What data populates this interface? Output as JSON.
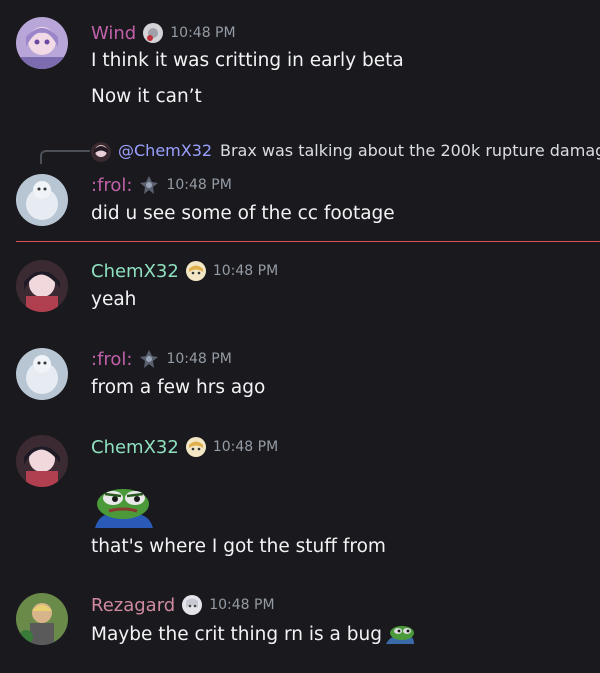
{
  "colors": {
    "wind": "#c060a8",
    "frol": "#c060a8",
    "chem": "#8fe0c0",
    "rezagard": "#d08aa0",
    "mention": "#9aa0ff",
    "divider": "#e0525a"
  },
  "messages": [
    {
      "user": "Wind",
      "time": "10:48 PM",
      "lines": [
        "I think it was critting in early beta",
        "Now it can’t"
      ]
    },
    {
      "reply": {
        "mention": "@ChemX32",
        "text": "Brax was talking about the 200k rupture damag"
      },
      "user": ":frol:",
      "time": "10:48 PM",
      "lines": [
        "did u see some of the cc footage"
      ]
    },
    {
      "user": "ChemX32",
      "time": "10:48 PM",
      "lines": [
        "yeah"
      ]
    },
    {
      "user": ":frol:",
      "time": "10:48 PM",
      "lines": [
        "from a few hrs ago"
      ]
    },
    {
      "user": "ChemX32",
      "time": "10:48 PM",
      "emoji": "pepe-frog-emoji",
      "lines": [
        "that's where I got the stuff from"
      ]
    },
    {
      "user": "Rezagard",
      "time": "10:48 PM",
      "lines": [
        "Maybe the crit thing rn is a bug"
      ],
      "trailing_emoji": "frog-emoji"
    }
  ]
}
